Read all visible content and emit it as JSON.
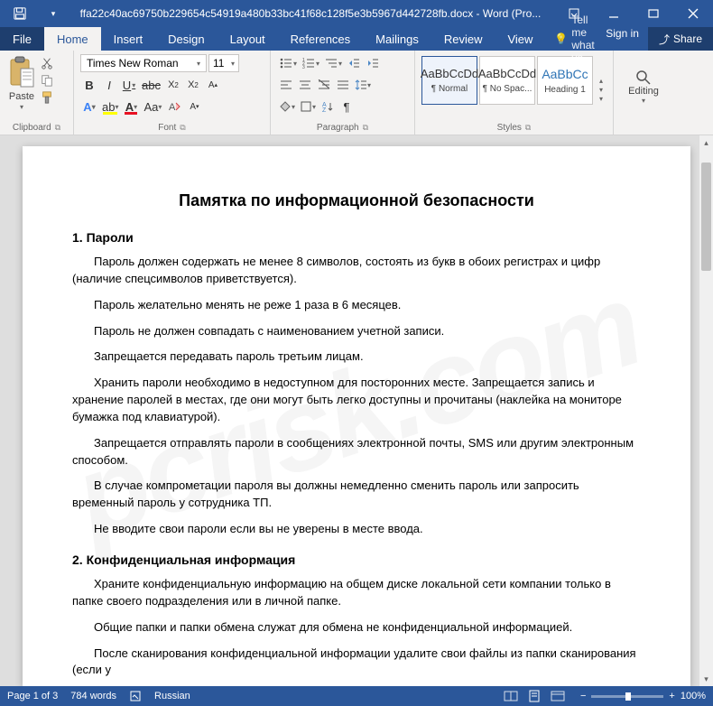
{
  "titlebar": {
    "filename": "ffa22c40ac69750b229654c54919a480b33bc41f68c128f5e3b5967d442728fb.docx - Word (Pro..."
  },
  "tabs": {
    "file": "File",
    "home": "Home",
    "insert": "Insert",
    "design": "Design",
    "layout": "Layout",
    "references": "References",
    "mailings": "Mailings",
    "review": "Review",
    "view": "View",
    "tellme": "Tell me what yo",
    "signin": "Sign in",
    "share": "Share"
  },
  "ribbon": {
    "clipboard": {
      "paste": "Paste",
      "label": "Clipboard"
    },
    "font": {
      "name": "Times New Roman",
      "size": "11",
      "label": "Font"
    },
    "paragraph": {
      "label": "Paragraph"
    },
    "styles": {
      "normal": {
        "preview": "AaBbCcDd",
        "name": "¶ Normal"
      },
      "nospac": {
        "preview": "AaBbCcDd",
        "name": "¶ No Spac..."
      },
      "heading1": {
        "preview": "AaBbCc",
        "name": "Heading 1"
      },
      "label": "Styles"
    },
    "editing": {
      "label": "Editing"
    }
  },
  "document": {
    "title": "Памятка по информационной безопасности",
    "sections": [
      {
        "heading": "1. Пароли",
        "paras": [
          "Пароль должен содержать не менее 8 символов, состоять из букв в обоих регистрах и цифр (наличие спецсимволов приветствуется).",
          "Пароль желательно менять не реже 1 раза в 6 месяцев.",
          "Пароль не должен совпадать с наименованием учетной записи.",
          "Запрещается передавать пароль третьим лицам.",
          "Хранить пароли необходимо в недоступном для посторонних месте. Запрещается запись и хранение паролей в местах, где они могут быть легко доступны и прочитаны (наклейка на мониторе бумажка под клавиатурой).",
          "Запрещается отправлять пароли в сообщениях электронной почты, SMS или другим электронным способом.",
          "В случае компрометации пароля вы должны немедленно сменить пароль или запросить временный пароль у сотрудника ТП.",
          "Не вводите свои пароли если вы не уверены в месте ввода."
        ]
      },
      {
        "heading": "2. Конфиденциальная информация",
        "paras": [
          "Храните конфиденциальную информацию на общем диске локальной сети компании только в папке своего подразделения или в личной папке.",
          "Общие папки и папки обмена служат для обмена не конфиденциальной информацией.",
          "После сканирования конфиденциальной информации удалите свои файлы из папки сканирования (если у"
        ]
      }
    ]
  },
  "statusbar": {
    "page": "Page 1 of 3",
    "words": "784 words",
    "lang": "Russian",
    "zoom": "100%"
  },
  "watermark": "pcrisk.com"
}
